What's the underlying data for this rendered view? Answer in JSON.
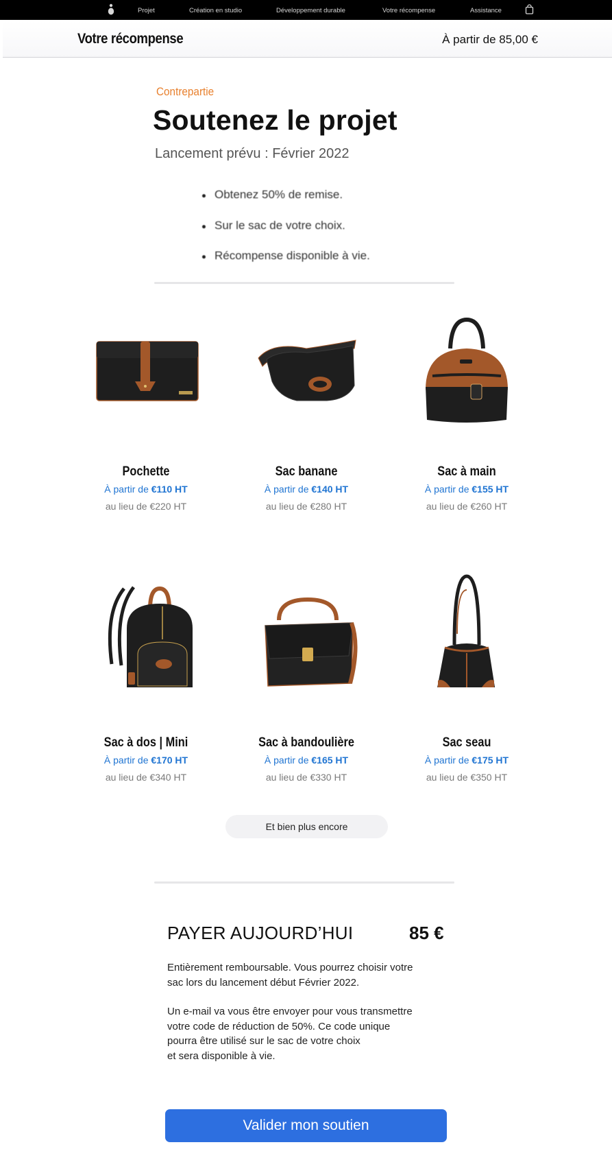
{
  "global_nav": {
    "items": [
      "Projet",
      "Création en studio",
      "Développement durable",
      "Votre récompense",
      "Assistance"
    ],
    "logo_icon": "brand-logo-icon",
    "bag_icon": "shopping-bag-icon"
  },
  "local_nav": {
    "title": "Votre récompense",
    "price": "À partir de 85,00 €"
  },
  "intro": {
    "eyebrow": "Contrepartie",
    "headline": "Soutenez le projet",
    "subline": "Lancement prévu : Février 2022",
    "bullets": [
      "Obtenez 50% de remise.",
      "Sur le sac de votre choix.",
      "Récompense disponible à vie."
    ]
  },
  "products": [
    {
      "name": "Pochette",
      "sale_prefix": "À partir de ",
      "sale_price": "€110 HT",
      "original": "au lieu de €220 HT",
      "icon": "clutch-bag-icon"
    },
    {
      "name": "Sac banane",
      "sale_prefix": "À partir de ",
      "sale_price": "€140 HT",
      "original": "au lieu de €280 HT",
      "icon": "belt-bag-icon"
    },
    {
      "name": "Sac à main",
      "sale_prefix": "À partir de ",
      "sale_price": "€155 HT",
      "original": "au lieu de €260 HT",
      "icon": "handbag-icon"
    },
    {
      "name": "Sac à dos | Mini",
      "sale_prefix": "À partir de ",
      "sale_price": "€170 HT",
      "original": "au lieu de €340 HT",
      "icon": "backpack-icon"
    },
    {
      "name": "Sac à bandoulière",
      "sale_prefix": "À partir de ",
      "sale_price": "€165 HT",
      "original": "au lieu de €330 HT",
      "icon": "shoulder-bag-icon"
    },
    {
      "name": "Sac seau",
      "sale_prefix": "À partir de ",
      "sale_price": "€175 HT",
      "original": "au lieu de €350 HT",
      "icon": "bucket-bag-icon"
    }
  ],
  "more_button": "Et bien plus encore",
  "payment": {
    "title": "PAYER AUJOURD’HUI",
    "amount": "85 €",
    "paragraph1": [
      "Entièrement remboursable. Vous pourrez choisir votre",
      "sac lors du lancement début Février 2022."
    ],
    "paragraph2": [
      "Un e-mail va vous être envoyer pour vous transmettre",
      "votre code de réduction de 50%. Ce code unique",
      "pourra être utilisé sur le sac de votre choix",
      "et sera disponible à vie."
    ]
  },
  "cta": "Valider mon soutien",
  "colors": {
    "accent_orange": "#e8812f",
    "price_blue": "#1f74d2",
    "cta_blue": "#2d6fe0",
    "leather_black": "#1e1e1e",
    "leather_tan": "#a3582a"
  }
}
